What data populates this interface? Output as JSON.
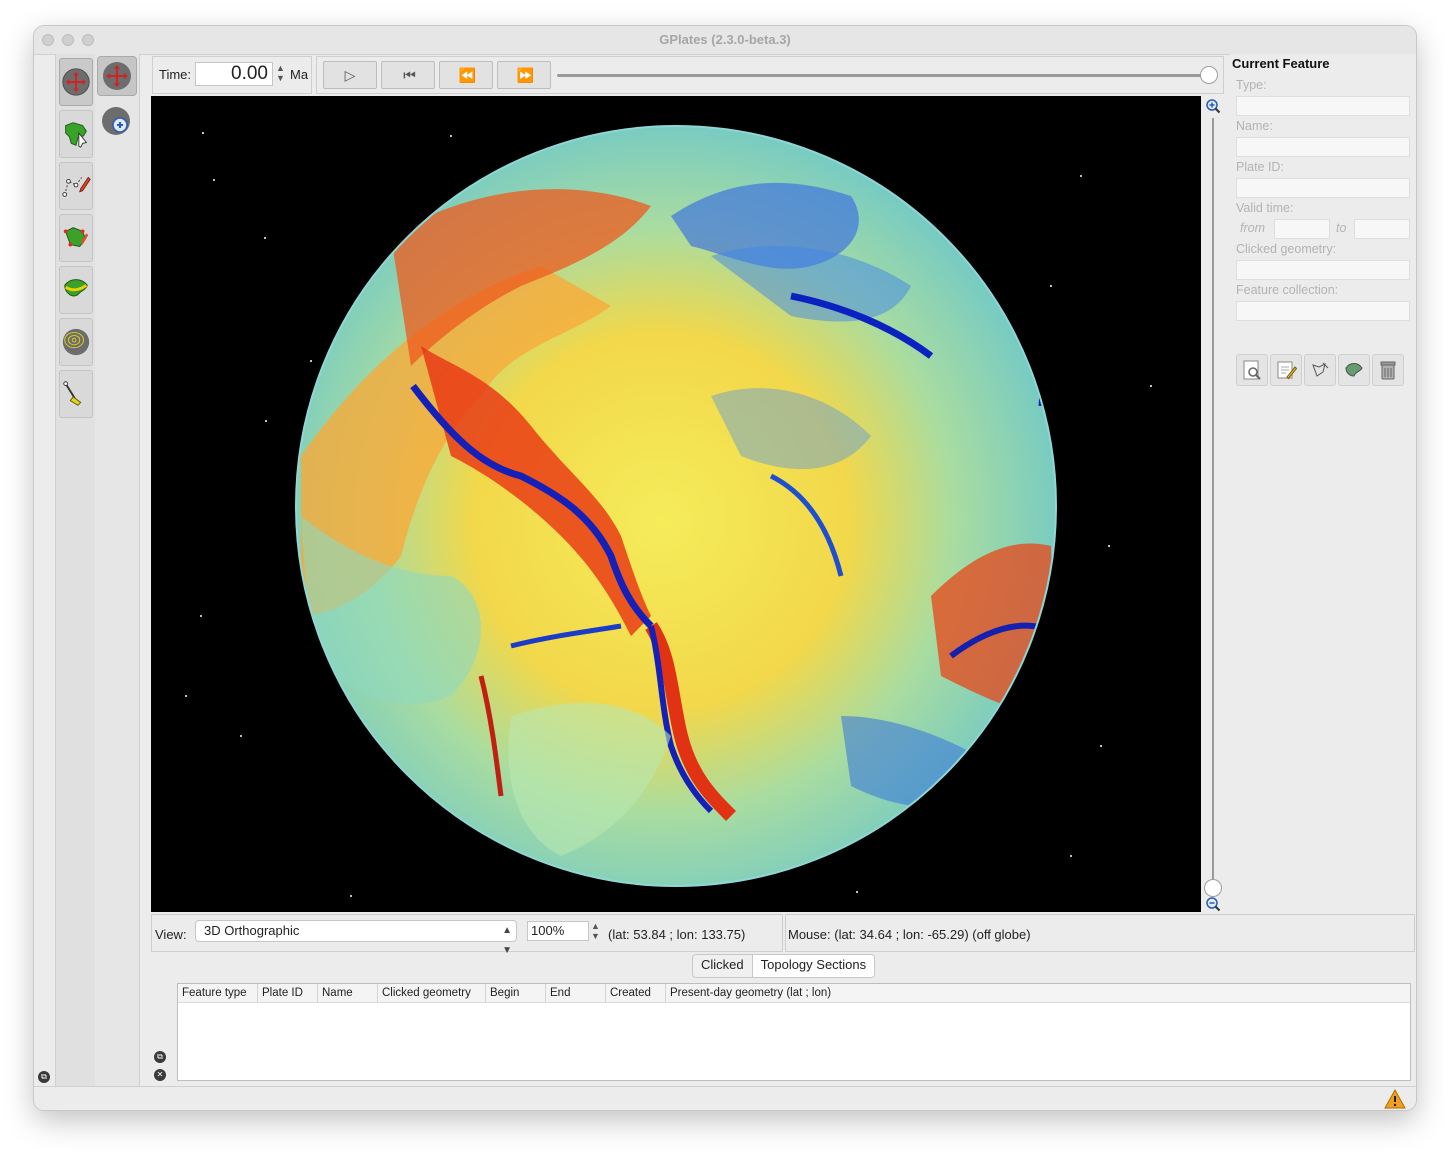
{
  "window": {
    "title": "GPlates (2.3.0-beta.3)"
  },
  "toolbox": {
    "main_tools": [
      {
        "icon": "drag-globe-icon"
      },
      {
        "icon": "choose-feature-icon"
      },
      {
        "icon": "digitise-geometry-icon"
      },
      {
        "icon": "modify-geometry-icon"
      },
      {
        "icon": "topology-tool-icon"
      },
      {
        "icon": "small-circle-icon"
      },
      {
        "icon": "measure-distance-icon"
      }
    ],
    "sub_tools": [
      {
        "icon": "drag-globe-icon"
      },
      {
        "icon": "zoom-globe-icon"
      }
    ]
  },
  "time": {
    "label": "Time:",
    "value": "0.00",
    "unit": "Ma"
  },
  "animation": {
    "buttons": [
      {
        "name": "play-button",
        "glyph": "▷"
      },
      {
        "name": "reset-button",
        "glyph": "⏮"
      },
      {
        "name": "step-back-button",
        "glyph": "⏪"
      },
      {
        "name": "step-forward-button",
        "glyph": "⏩"
      }
    ],
    "slider_position": 1.0
  },
  "globe": {
    "zoom_slider_position": 0.0
  },
  "current_feature": {
    "heading": "Current Feature",
    "type_label": "Type:",
    "name_label": "Name:",
    "plate_id_label": "Plate ID:",
    "valid_time_label": "Valid time:",
    "from_label": "from",
    "to_label": "to",
    "clicked_geometry_label": "Clicked geometry:",
    "feature_collection_label": "Feature collection:",
    "actions": [
      {
        "icon": "query-feature-icon"
      },
      {
        "icon": "edit-feature-icon"
      },
      {
        "icon": "clone-geometry-icon"
      },
      {
        "icon": "create-feature-icon"
      },
      {
        "icon": "delete-feature-icon"
      }
    ]
  },
  "view": {
    "label": "View:",
    "projection": "3D Orthographic",
    "zoom": "100%",
    "camera": "(lat: 53.84 ; lon: 133.75)",
    "mouse": "Mouse: (lat: 34.64 ; lon: -65.29) (off globe)"
  },
  "results": {
    "tabs": [
      "Clicked",
      "Topology Sections"
    ],
    "selected_tab": "Topology Sections",
    "columns": [
      "Feature type",
      "Plate ID",
      "Name",
      "Clicked geometry",
      "Begin",
      "End",
      "Created",
      "Present-day geometry (lat ; lon)"
    ]
  },
  "colors": {
    "canvas_background": "#000000",
    "anomaly_high": "#e52d12",
    "anomaly_mid": "#f7e64a",
    "anomaly_low": "#1f3fd2"
  }
}
